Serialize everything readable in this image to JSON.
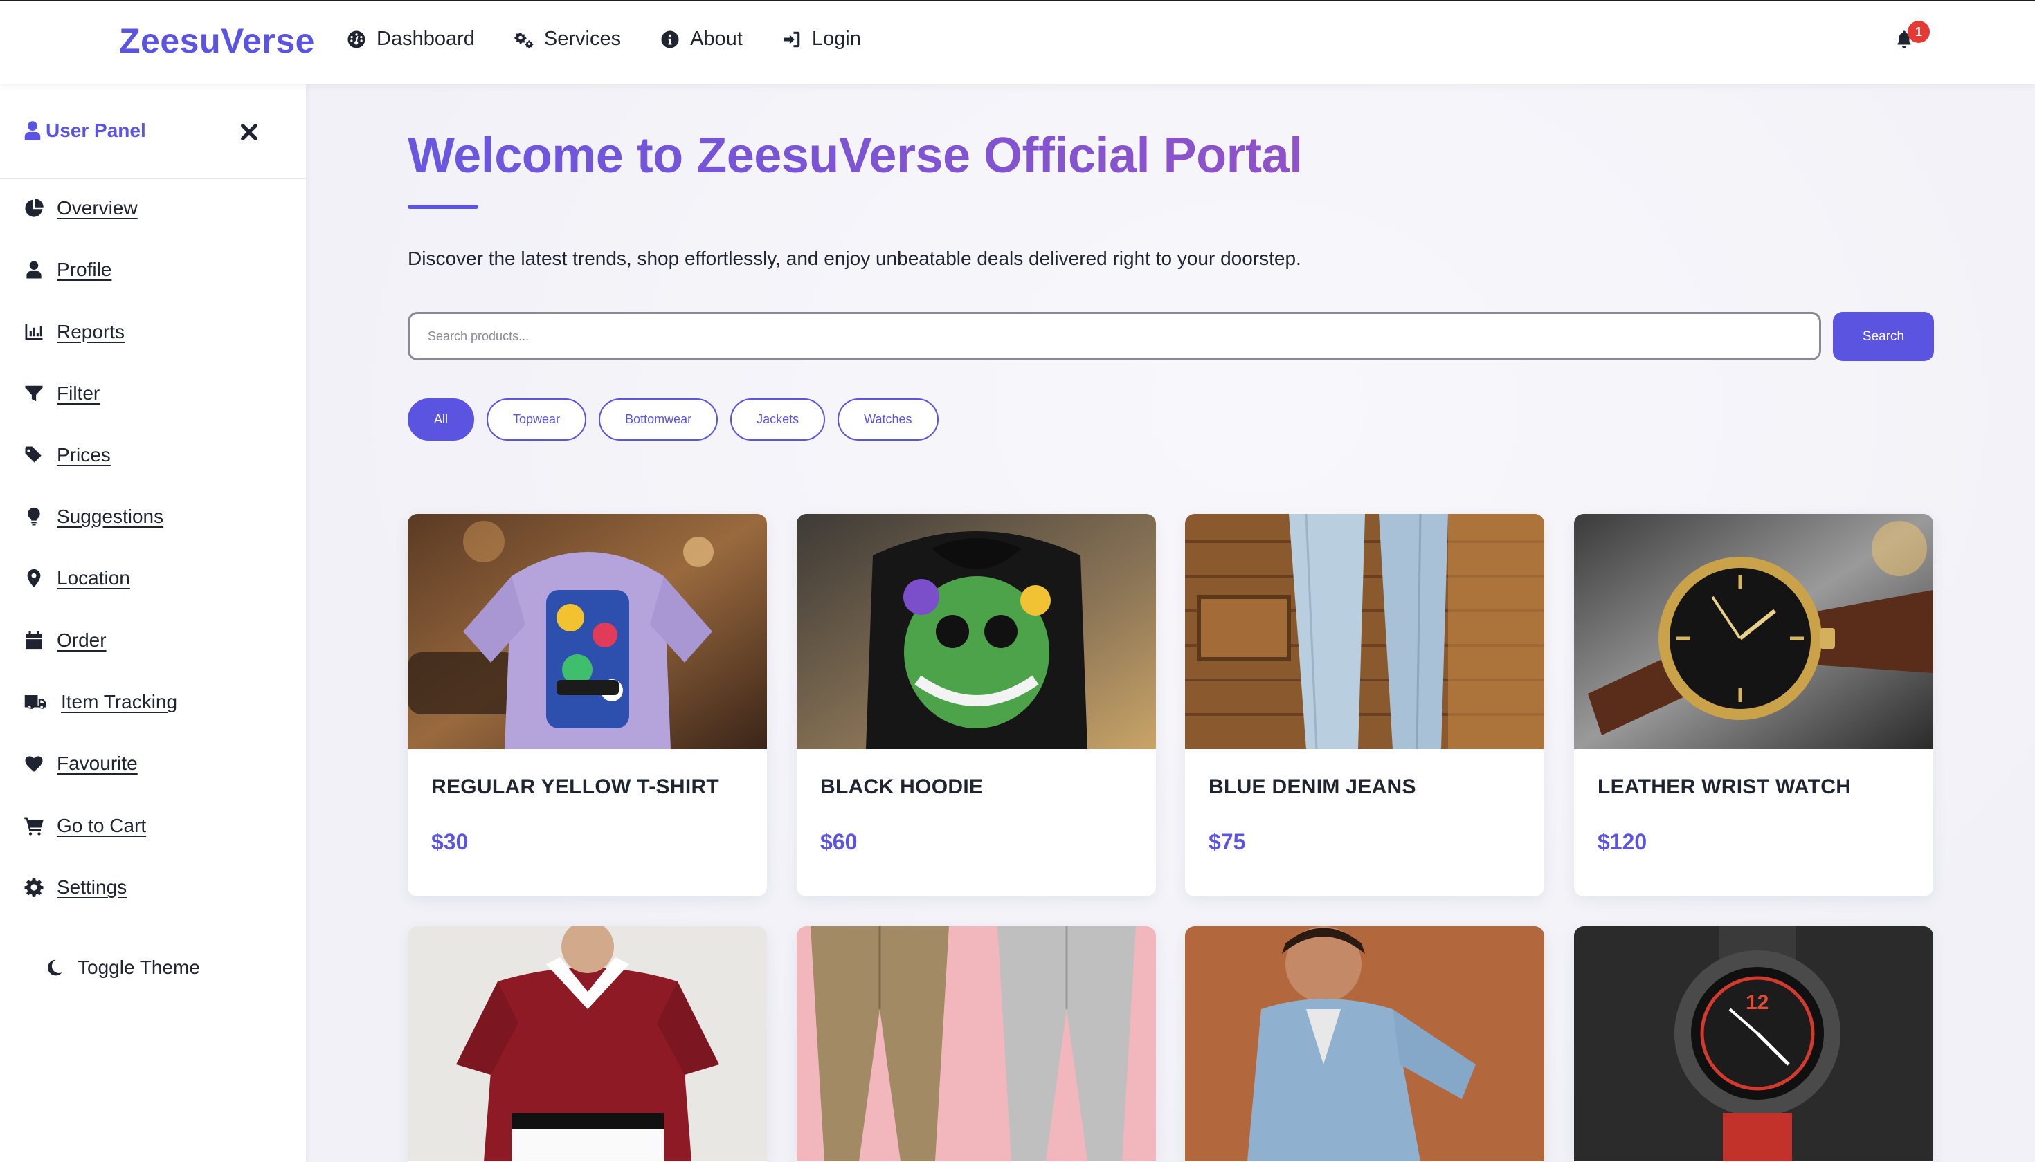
{
  "brand": "ZeesuVerse",
  "nav": {
    "links": [
      {
        "label": "Dashboard",
        "icon": "dashboard-gauge-icon"
      },
      {
        "label": "Services",
        "icon": "cogs-icon"
      },
      {
        "label": "About",
        "icon": "info-circle-icon"
      },
      {
        "label": "Login",
        "icon": "sign-in-icon"
      }
    ],
    "notifications_count": "1"
  },
  "sidebar": {
    "title": "User Panel",
    "items": [
      {
        "label": "Overview",
        "icon": "chart-pie-icon"
      },
      {
        "label": "Profile",
        "icon": "user-icon"
      },
      {
        "label": "Reports",
        "icon": "bar-chart-icon"
      },
      {
        "label": "Filter",
        "icon": "filter-icon"
      },
      {
        "label": "Prices",
        "icon": "tags-icon"
      },
      {
        "label": "Suggestions",
        "icon": "lightbulb-icon"
      },
      {
        "label": "Location",
        "icon": "map-marker-icon"
      },
      {
        "label": "Order",
        "icon": "calendar-icon"
      },
      {
        "label": "Item Tracking",
        "icon": "truck-icon"
      },
      {
        "label": "Favourite",
        "icon": "heart-icon"
      },
      {
        "label": "Go to Cart",
        "icon": "shopping-cart-icon"
      },
      {
        "label": "Settings",
        "icon": "gear-icon"
      }
    ],
    "toggle_theme": "Toggle Theme"
  },
  "hero": {
    "title": "Welcome to ZeesuVerse Official Portal",
    "subtitle": "Discover the latest trends, shop effortlessly, and enjoy unbeatable deals delivered right to your doorstep."
  },
  "search": {
    "placeholder": "Search products...",
    "button": "Search"
  },
  "filters": {
    "active": "All",
    "options": [
      "All",
      "Topwear",
      "Bottomwear",
      "Jackets",
      "Watches"
    ]
  },
  "products": [
    {
      "name": "REGULAR YELLOW T-SHIRT",
      "price": "$30"
    },
    {
      "name": "BLACK HOODIE",
      "price": "$60"
    },
    {
      "name": "BLUE DENIM JEANS",
      "price": "$75"
    },
    {
      "name": "LEATHER WRIST WATCH",
      "price": "$120"
    },
    {
      "name": "",
      "price": ""
    },
    {
      "name": "",
      "price": ""
    },
    {
      "name": "",
      "price": ""
    },
    {
      "name": "",
      "price": ""
    }
  ],
  "colors": {
    "accent": "#5b54e0",
    "accent_gradient_end": "#8f52c8",
    "badge": "#e53935",
    "text": "#1f2430"
  }
}
